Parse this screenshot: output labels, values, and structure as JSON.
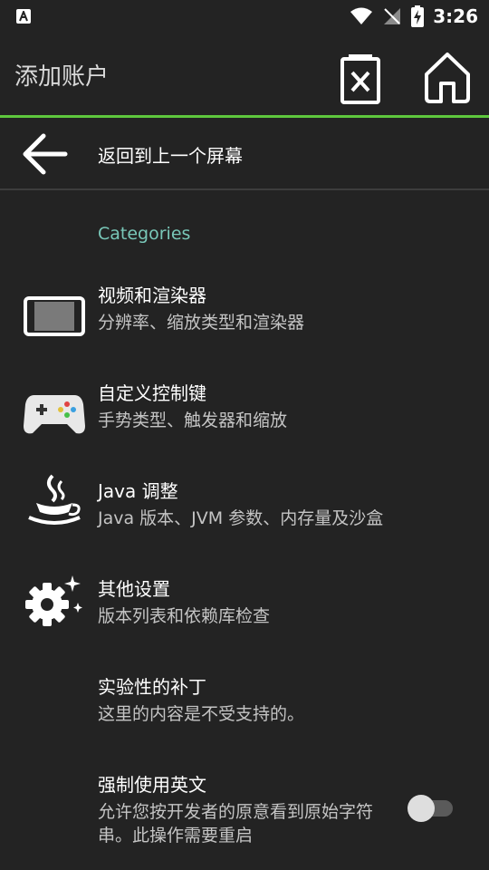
{
  "status_bar": {
    "time": "3:26"
  },
  "app_bar": {
    "title": "添加账户"
  },
  "back": {
    "label": "返回到上一个屏幕"
  },
  "section": {
    "header": "Categories"
  },
  "items": [
    {
      "title": "视频和渲染器",
      "summary": "分辨率、缩放类型和渲染器"
    },
    {
      "title": "自定义控制键",
      "summary": "手势类型、触发器和缩放"
    },
    {
      "title": "Java 调整",
      "summary": "Java 版本、JVM 参数、内存量及沙盒"
    },
    {
      "title": "其他设置",
      "summary": "版本列表和依赖库检查"
    },
    {
      "title": "实验性的补丁",
      "summary": "这里的内容是不受支持的。"
    },
    {
      "title": "强制使用英文",
      "summary": "允许您按开发者的原意看到原始字符串。此操作需要重启"
    }
  ],
  "toggle_force_english": {
    "checked": false
  },
  "colors": {
    "accent": "#5ec73d",
    "category": "#79c7b8",
    "background": "#232323"
  }
}
